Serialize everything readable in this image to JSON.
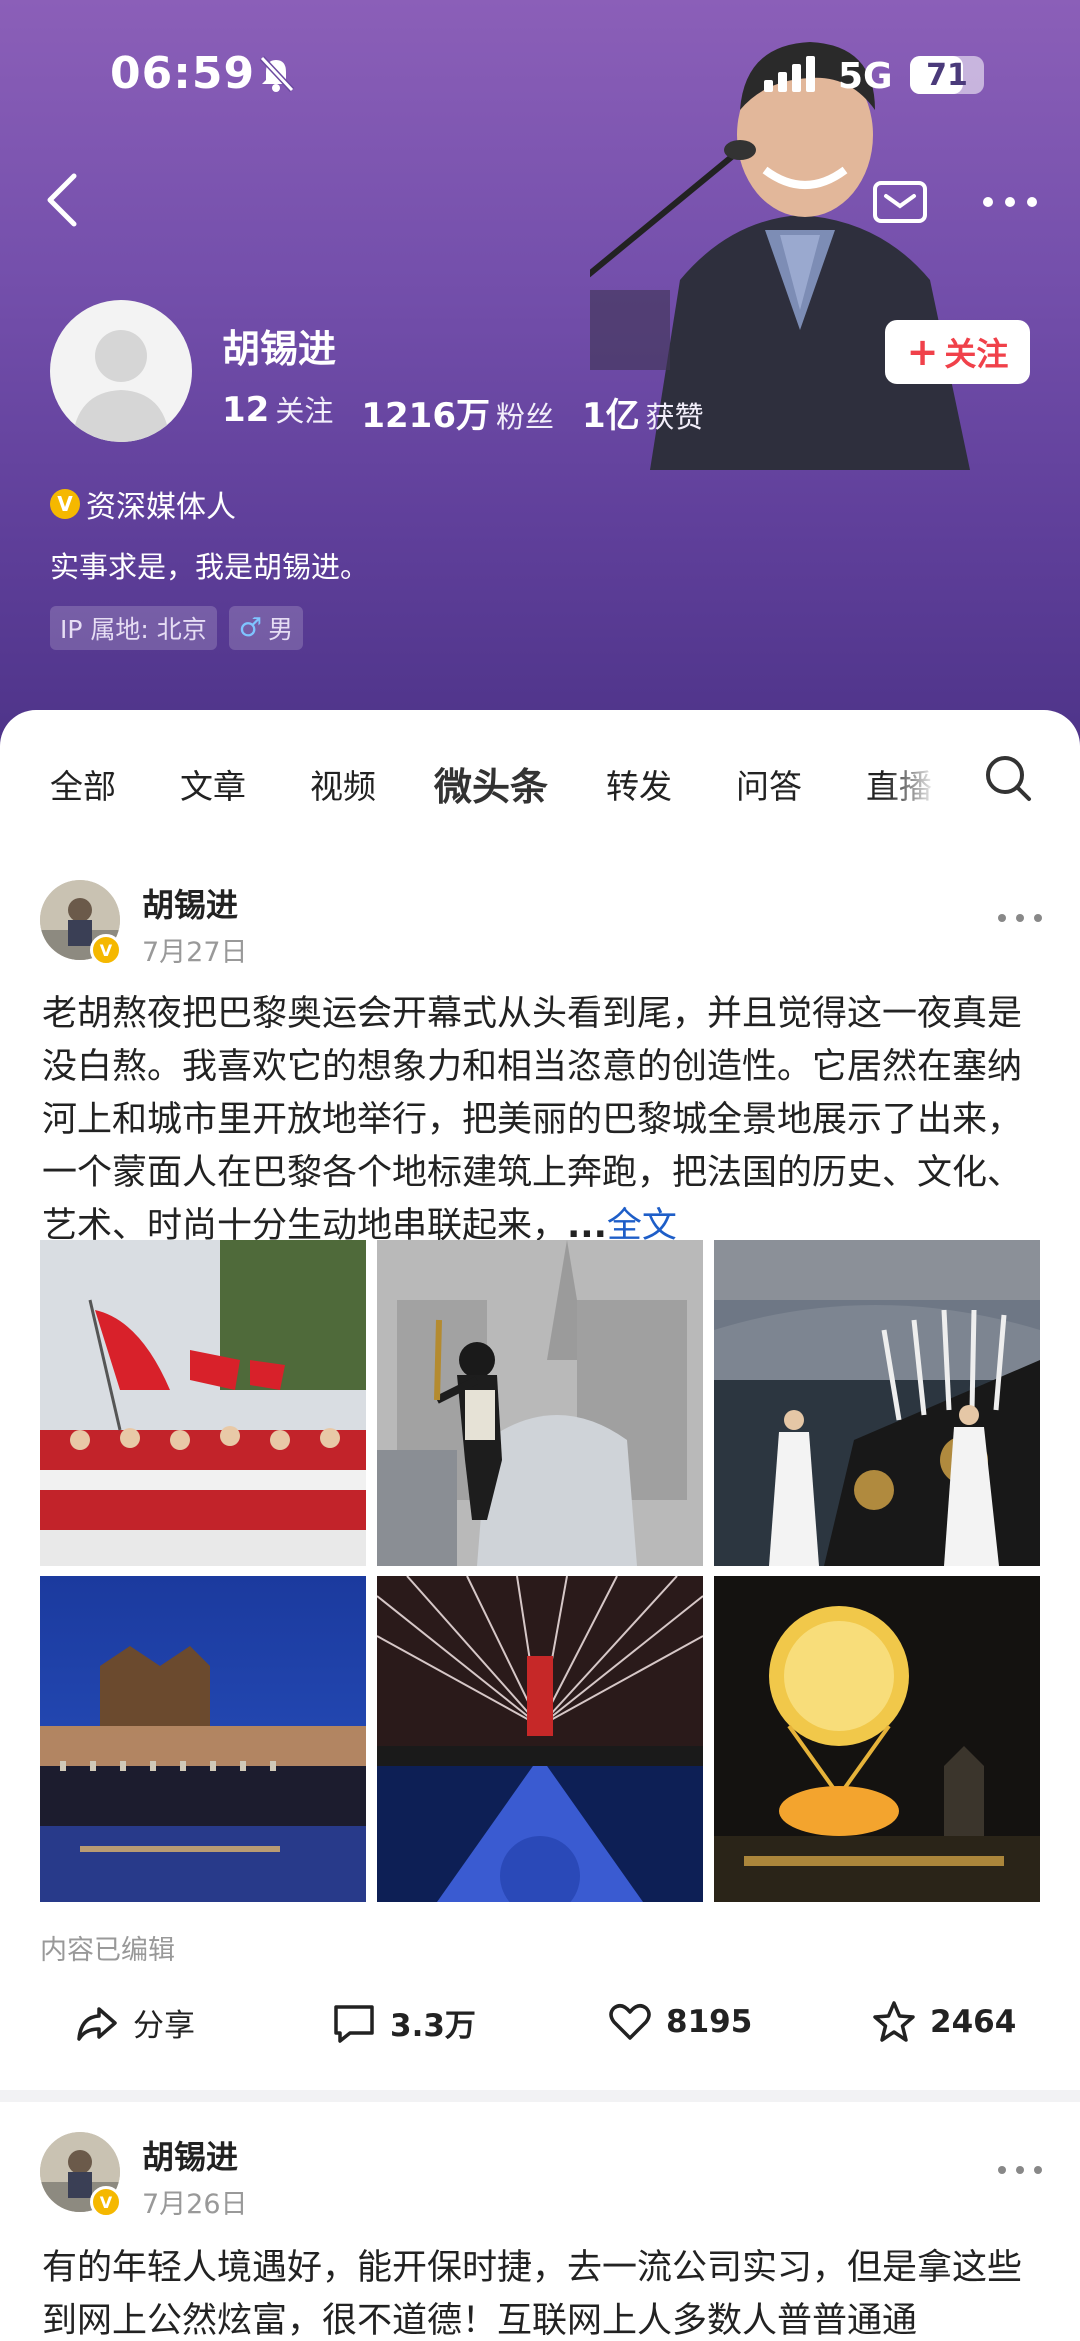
{
  "status_bar": {
    "time": "06:59",
    "network": "5G",
    "battery": "71",
    "battery_level": 0.71
  },
  "profile": {
    "name": "胡锡进",
    "stats": [
      {
        "value": "12",
        "label": "关注"
      },
      {
        "value": "1216万",
        "label": "粉丝"
      },
      {
        "value": "1亿",
        "label": "获赞"
      }
    ],
    "follow_label": "关注",
    "verification": "资深媒体人",
    "bio": "实事求是，我是胡锡进。",
    "ip_tag": "IP 属地: 北京",
    "gender_tag": "男"
  },
  "tabs": [
    "全部",
    "文章",
    "视频",
    "微头条",
    "转发",
    "问答",
    "直播"
  ],
  "active_tab": "微头条",
  "posts": [
    {
      "author": "胡锡进",
      "date": "7月27日",
      "text": "老胡熬夜把巴黎奥运会开幕式从头看到尾，并且觉得这一夜真是没白熬。我喜欢它的想象力和相当恣意的创造性。它居然在塞纳河上和城市里开放地举行，把美丽的巴黎城全景地展示了出来，一个蒙面人在巴黎各个地标建筑上奔跑，把法国的历史、文化、艺术、时尚十分生动地串联起来，",
      "ellipsis": "...",
      "full_text_link": "全文",
      "edited_note": "内容已编辑",
      "actions": {
        "share": "分享",
        "comments": "3.3万",
        "likes": "8195",
        "favorites": "2464"
      }
    },
    {
      "author": "胡锡进",
      "date": "7月26日",
      "text": "有的年轻人境遇好，能开保时捷，去一流公司实习，但是拿这些到网上公然炫富，很不道德！互联网上人多数人普普通通"
    }
  ],
  "icons": {
    "back": "chevron-left-icon",
    "mail": "mail-icon",
    "more": "more-icon",
    "search": "search-icon",
    "share": "share-icon",
    "comment": "comment-icon",
    "like": "heart-icon",
    "favorite": "star-icon",
    "mute": "bell-off-icon",
    "signal": "signal-icon",
    "verified": "verified-badge-icon"
  },
  "colors": {
    "header_top": "#8b5fb8",
    "header_bottom": "#4d3388",
    "follow_red": "#f0414a",
    "link_blue": "#1e5ec8",
    "verify_gold": "#f5b800"
  }
}
